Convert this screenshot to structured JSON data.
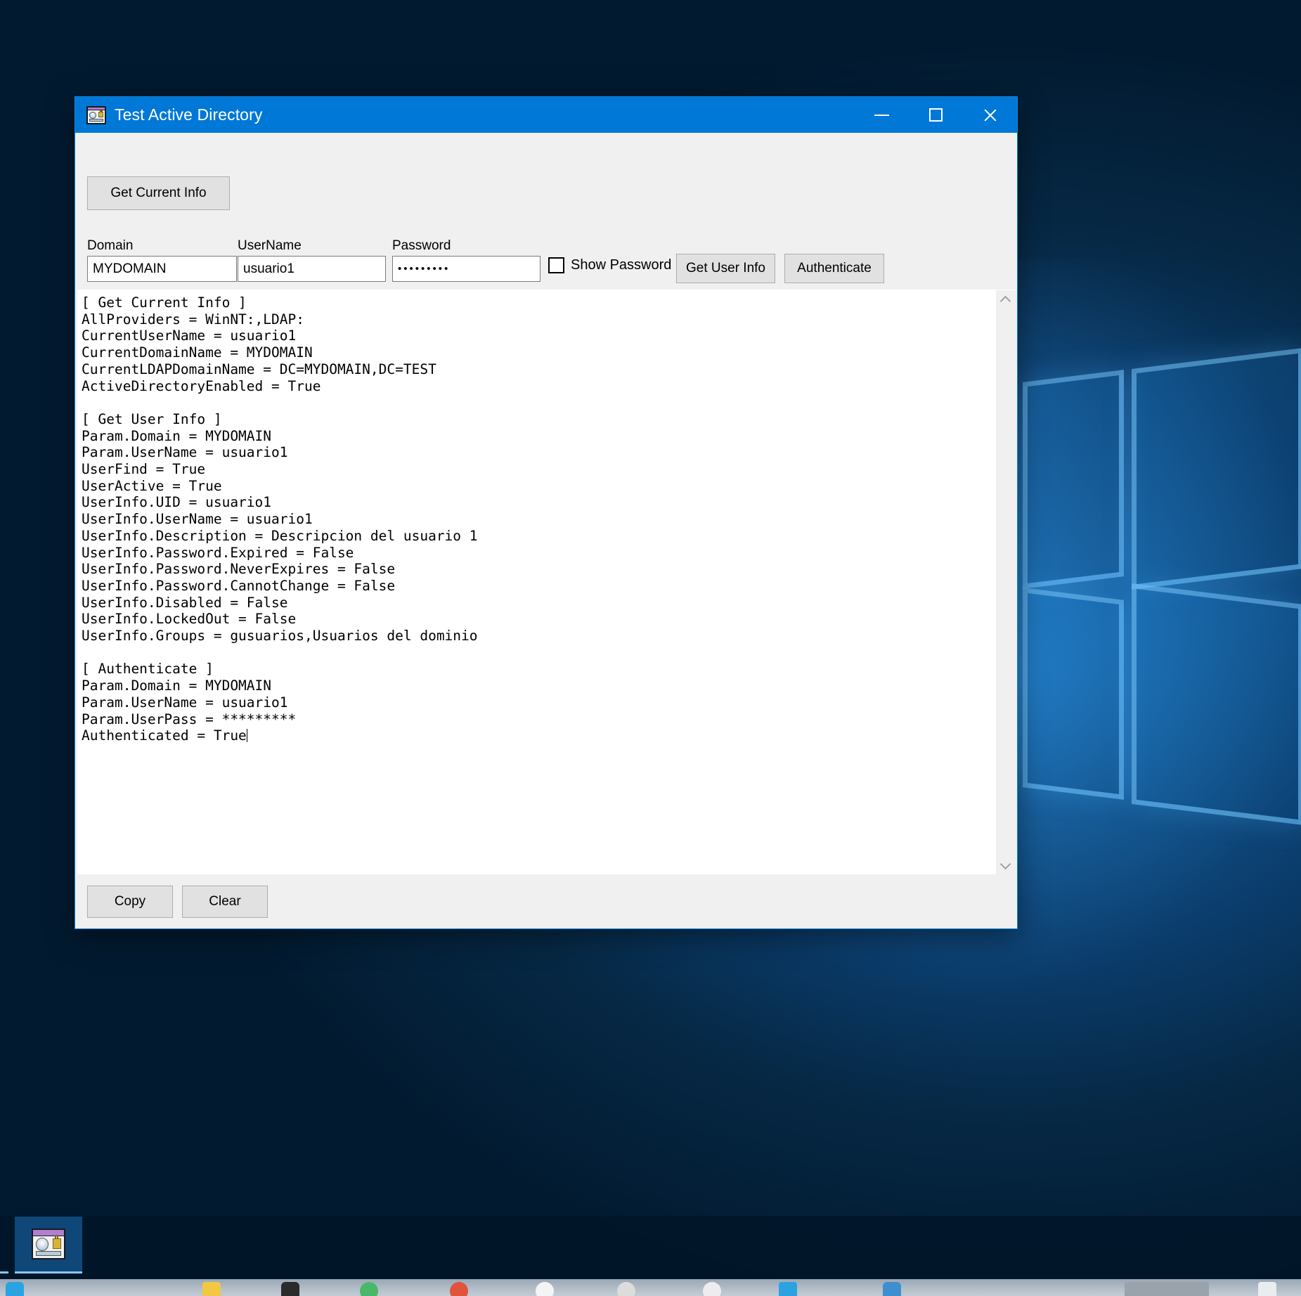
{
  "window": {
    "title": "Test Active Directory",
    "icon": "active-directory-app-icon",
    "controls": {
      "minimize": "minimize",
      "maximize": "maximize",
      "close": "close"
    },
    "accent_color": "#0078d7",
    "border_color": "#1488e0"
  },
  "toolbar": {
    "get_current_info_label": "Get Current Info"
  },
  "form": {
    "domain": {
      "label": "Domain",
      "value": "MYDOMAIN"
    },
    "username": {
      "label": "UserName",
      "value": "usuario1"
    },
    "password": {
      "label": "Password",
      "value": "•••••••••",
      "masked": true
    },
    "show_password": {
      "label": "Show Password",
      "checked": false
    },
    "get_user_info_label": "Get User Info",
    "authenticate_label": "Authenticate"
  },
  "output": {
    "text": "[ Get Current Info ]\nAllProviders = WinNT:,LDAP:\nCurrentUserName = usuario1\nCurrentDomainName = MYDOMAIN\nCurrentLDAPDomainName = DC=MYDOMAIN,DC=TEST\nActiveDirectoryEnabled = True\n\n[ Get User Info ]\nParam.Domain = MYDOMAIN\nParam.UserName = usuario1\nUserFind = True\nUserActive = True\nUserInfo.UID = usuario1\nUserInfo.UserName = usuario1\nUserInfo.Description = Descripcion del usuario 1\nUserInfo.Password.Expired = False\nUserInfo.Password.NeverExpires = False\nUserInfo.Password.CannotChange = False\nUserInfo.Disabled = False\nUserInfo.LockedOut = False\nUserInfo.Groups = gusuarios,Usuarios del dominio\n\n[ Authenticate ]\nParam.Domain = MYDOMAIN\nParam.UserName = usuario1\nParam.UserPass = *********\nAuthenticated = True",
    "scrollbar": {
      "up_arrow": "chevron-up-icon",
      "down_arrow": "chevron-down-icon"
    }
  },
  "footer": {
    "copy_label": "Copy",
    "clear_label": "Clear"
  },
  "taskbar": {
    "item_icon": "active-directory-app-icon"
  }
}
